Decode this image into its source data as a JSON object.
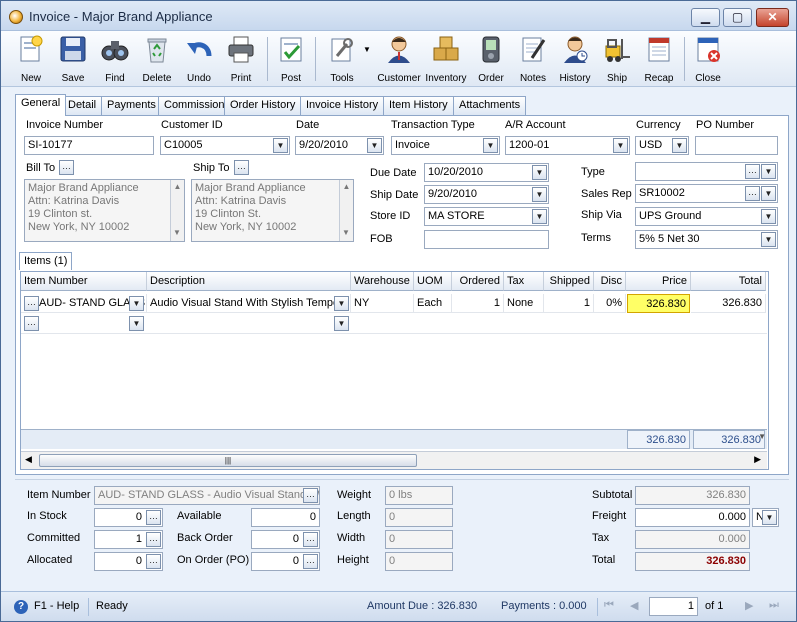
{
  "window": {
    "title": "Invoice - Major Brand Appliance"
  },
  "toolbar": [
    {
      "name": "new-button",
      "label": "New",
      "icon": "new-icon"
    },
    {
      "name": "save-button",
      "label": "Save",
      "icon": "save-icon"
    },
    {
      "name": "find-button",
      "label": "Find",
      "icon": "binoculars-icon"
    },
    {
      "name": "delete-button",
      "label": "Delete",
      "icon": "recycle-bin-icon"
    },
    {
      "name": "undo-button",
      "label": "Undo",
      "icon": "undo-arrow-icon"
    },
    {
      "name": "print-button",
      "label": "Print",
      "icon": "printer-icon"
    },
    {
      "name": "post-button",
      "label": "Post",
      "icon": "post-check-icon"
    },
    {
      "name": "tools-button",
      "label": "Tools",
      "icon": "tools-icon"
    },
    {
      "name": "customer-button",
      "label": "Customer",
      "icon": "customer-icon"
    },
    {
      "name": "inventory-button",
      "label": "Inventory",
      "icon": "boxes-icon"
    },
    {
      "name": "order-button",
      "label": "Order",
      "icon": "order-device-icon"
    },
    {
      "name": "notes-button",
      "label": "Notes",
      "icon": "notepad-icon"
    },
    {
      "name": "history-button",
      "label": "History",
      "icon": "history-person-icon"
    },
    {
      "name": "ship-button",
      "label": "Ship",
      "icon": "forklift-icon"
    },
    {
      "name": "recap-button",
      "label": "Recap",
      "icon": "recap-sheet-icon"
    },
    {
      "name": "close-button",
      "label": "Close",
      "icon": "close-door-icon"
    }
  ],
  "tabs": [
    "General",
    "Detail",
    "Payments",
    "Commission",
    "Order History",
    "Invoice History",
    "Item History",
    "Attachments"
  ],
  "header": {
    "invoice_number_label": "Invoice Number",
    "invoice_number": "SI-10177",
    "customer_id_label": "Customer ID",
    "customer_id": "C10005",
    "date_label": "Date",
    "date": "9/20/2010",
    "transaction_type_label": "Transaction Type",
    "transaction_type": "Invoice",
    "ar_account_label": "A/R Account",
    "ar_account": "1200-01",
    "currency_label": "Currency",
    "currency": "USD",
    "po_number_label": "PO Number",
    "po_number": ""
  },
  "bill_to": {
    "label": "Bill To",
    "lines": [
      "Major Brand Appliance",
      "Attn: Katrina Davis",
      "19 Clinton st.",
      "New York, NY 10002"
    ]
  },
  "ship_to": {
    "label": "Ship To",
    "lines": [
      "Major Brand Appliance",
      "Attn: Katrina Davis",
      "19 Clinton St.",
      "New York, NY 10002"
    ]
  },
  "dates": {
    "due_date_label": "Due Date",
    "due_date": "10/20/2010",
    "ship_date_label": "Ship Date",
    "ship_date": "9/20/2010",
    "store_id_label": "Store ID",
    "store_id": "MA STORE",
    "fob_label": "FOB",
    "fob": ""
  },
  "right_fields": {
    "type_label": "Type",
    "type": "",
    "sales_rep_label": "Sales Rep",
    "sales_rep": "SR10002",
    "ship_via_label": "Ship Via",
    "ship_via": "UPS Ground",
    "terms_label": "Terms",
    "terms": "5% 5 Net 30"
  },
  "items_tab": "Items (1)",
  "grid": {
    "columns": [
      "Item Number",
      "Description",
      "Warehouse",
      "UOM",
      "Ordered",
      "Tax",
      "Shipped",
      "Disc",
      "Price",
      "Total"
    ],
    "rows": [
      {
        "item_number": "AUD- STAND GLASS",
        "description": "Audio Visual Stand With Stylish Temper",
        "warehouse": "NY",
        "uom": "Each",
        "ordered": "1",
        "tax": "None",
        "shipped": "1",
        "disc": "0%",
        "price": "326.830",
        "total": "326.830"
      }
    ],
    "footer_price": "326.830",
    "footer_total": "326.830"
  },
  "bottom": {
    "item_number_label": "Item Number",
    "item_number": "AUD- STAND GLASS - Audio Visual Stand W",
    "in_stock_label": "In Stock",
    "in_stock": "0",
    "committed_label": "Committed",
    "committed": "1",
    "allocated_label": "Allocated",
    "allocated": "0",
    "available_label": "Available",
    "available": "0",
    "back_order_label": "Back Order",
    "back_order": "0",
    "on_order_label": "On Order (PO)",
    "on_order": "0",
    "weight_label": "Weight",
    "weight": "0 lbs",
    "length_label": "Length",
    "length": "0",
    "width_label": "Width",
    "width": "0",
    "height_label": "Height",
    "height": "0",
    "subtotal_label": "Subtotal",
    "subtotal": "326.830",
    "freight_label": "Freight",
    "freight": "0.000",
    "freight_code": "N",
    "tax_label": "Tax",
    "tax": "0.000",
    "total_label": "Total",
    "total": "326.830"
  },
  "status": {
    "help": "F1 - Help",
    "state": "Ready",
    "amount_due": "Amount Due : 326.830",
    "payments": "Payments : 0.000",
    "page": "1",
    "of": "of 1"
  },
  "colors": {
    "accent": "#4a6a96",
    "highlight": "#ffff66",
    "total_red": "#8b0000"
  }
}
